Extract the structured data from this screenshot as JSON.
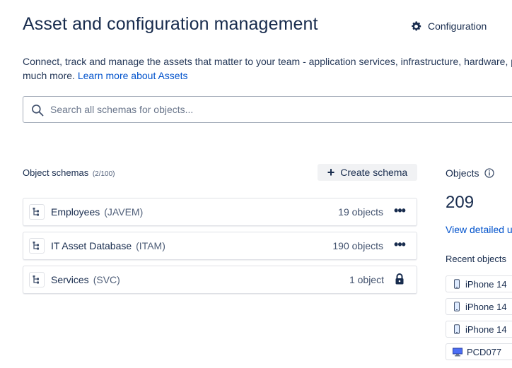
{
  "header": {
    "title": "Asset and configuration management",
    "config_label": "Configuration",
    "description_line1": "Connect, track and manage the assets that matter to your team - application services, infrastructure, hardware, p",
    "description_line2": "much more.",
    "learn_more": "Learn more about Assets"
  },
  "search": {
    "placeholder": "Search all schemas for objects...",
    "value": ""
  },
  "schemas": {
    "heading": "Object schemas",
    "count": "(2/100)",
    "create_label": "Create schema",
    "rows": [
      {
        "name": "Employees",
        "key": "(JAVEM)",
        "objects": "19 objects",
        "action": "more"
      },
      {
        "name": "IT Asset Database",
        "key": "(ITAM)",
        "objects": "190 objects",
        "action": "more"
      },
      {
        "name": "Services",
        "key": "(SVC)",
        "objects": "1 object",
        "action": "lock"
      }
    ]
  },
  "objects_panel": {
    "heading": "Objects",
    "total": "209",
    "view_link": "View detailed u",
    "recent_heading": "Recent objects",
    "recent": [
      {
        "label": "iPhone 14",
        "icon": "phone-icon"
      },
      {
        "label": "iPhone 14",
        "icon": "phone-icon"
      },
      {
        "label": "iPhone 14",
        "icon": "phone-icon"
      },
      {
        "label": "PCD077",
        "icon": "desktop-icon"
      }
    ]
  },
  "colors": {
    "link": "#0052cc",
    "text": "#172b4d",
    "highlight": "#f5f500"
  }
}
